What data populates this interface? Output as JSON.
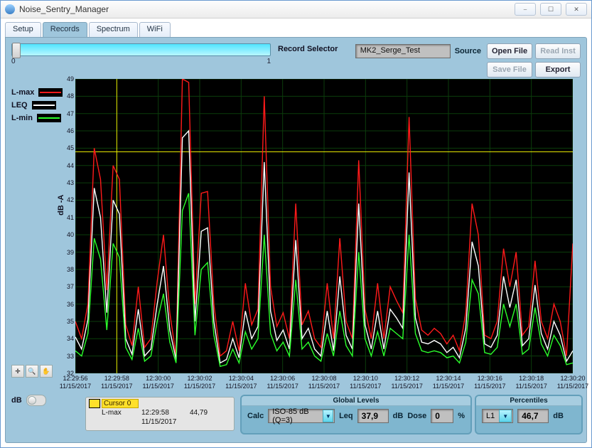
{
  "window": {
    "title": "Noise_Sentry_Manager"
  },
  "tabs": [
    "Setup",
    "Records",
    "Spectrum",
    "WiFi"
  ],
  "active_tab": 1,
  "record_selector": {
    "label": "Record Selector",
    "min": "0",
    "max": "1",
    "value": 0
  },
  "source": {
    "label": "Source",
    "value": "MK2_Serge_Test"
  },
  "buttons": {
    "open": "Open File",
    "read": "Read Inst",
    "save": "Save File",
    "export": "Export"
  },
  "legend": [
    {
      "name": "L-max",
      "color": "#ff1a1a"
    },
    {
      "name": "LEQ",
      "color": "#ffffff"
    },
    {
      "name": "L-min",
      "color": "#2bff2b"
    }
  ],
  "yaxis_label": "dB -A",
  "db_toggle_label": "dB",
  "cursor": {
    "name": "Cursor 0",
    "series": "L-max",
    "time": "12:29:58",
    "date": "11/15/2017",
    "value": "44,79"
  },
  "globals": {
    "title": "Global Levels",
    "calc_label": "Calc",
    "calc_value": "ISO-85 dB (Q=3)",
    "leq_label": "Leq",
    "leq_value": "37,9",
    "leq_unit": "dB",
    "dose_label": "Dose",
    "dose_value": "0",
    "dose_unit": "%"
  },
  "percentiles": {
    "title": "Percentiles",
    "selector": "L1",
    "value": "46,7",
    "unit": "dB"
  },
  "chart_data": {
    "type": "line",
    "xlabel": "",
    "ylabel": "dB -A",
    "ylim": [
      32,
      49
    ],
    "grid": true,
    "cursor": {
      "x": "12:29:58",
      "y": 44.8
    },
    "x_date": "11/15/2017",
    "x_ticks": [
      "12:29:56",
      "12:29:58",
      "12:30:00",
      "12:30:02",
      "12:30:04",
      "12:30:06",
      "12:30:08",
      "12:30:10",
      "12:30:12",
      "12:30:14",
      "12:30:16",
      "12:30:18",
      "12:30:20"
    ],
    "series": [
      {
        "name": "L-max",
        "color": "#ff1a1a",
        "values": [
          35.0,
          34.0,
          36.0,
          45.0,
          43.2,
          36.8,
          44.0,
          43.2,
          34.8,
          33.6,
          37.0,
          33.5,
          34.0,
          37.3,
          40.0,
          35.5,
          33.0,
          49.0,
          48.8,
          36.0,
          42.4,
          42.5,
          36.0,
          33.0,
          33.3,
          35.0,
          33.3,
          37.2,
          34.8,
          35.7,
          48.0,
          37.0,
          34.7,
          35.5,
          34.0,
          41.8,
          34.8,
          35.6,
          34.0,
          33.5,
          37.2,
          34.0,
          39.8,
          35.0,
          34.0,
          44.3,
          35.7,
          34.0,
          37.2,
          34.0,
          37.0,
          36.2,
          35.5,
          46.8,
          36.3,
          34.5,
          34.2,
          34.6,
          34.3,
          33.7,
          34.2,
          33.3,
          35.5,
          41.8,
          40.0,
          34.2,
          34.0,
          35.0,
          39.2,
          37.0,
          39.0,
          34.2,
          34.7,
          38.5,
          35.0,
          34.0,
          36.0,
          35.0,
          33.0,
          39.5
        ]
      },
      {
        "name": "LEQ",
        "color": "#ffffff",
        "values": [
          34.1,
          33.4,
          35.1,
          42.7,
          41.0,
          35.5,
          42.0,
          41.2,
          34.0,
          33.1,
          35.7,
          33.0,
          33.4,
          36.0,
          38.2,
          34.5,
          32.8,
          45.6,
          46.0,
          35.0,
          40.2,
          40.4,
          35.0,
          32.6,
          32.8,
          34.0,
          32.9,
          35.6,
          34.0,
          34.7,
          44.2,
          35.6,
          33.9,
          34.5,
          33.4,
          39.7,
          34.0,
          34.6,
          33.4,
          33.0,
          35.6,
          33.3,
          37.6,
          34.2,
          33.4,
          41.8,
          34.8,
          33.4,
          35.6,
          33.4,
          35.7,
          35.2,
          34.6,
          43.6,
          35.2,
          33.8,
          33.7,
          33.9,
          33.7,
          33.2,
          33.5,
          32.9,
          34.6,
          39.6,
          38.2,
          33.7,
          33.5,
          34.2,
          37.6,
          35.8,
          37.4,
          33.6,
          34.0,
          37.1,
          34.3,
          33.4,
          35.0,
          34.2,
          32.7,
          33.3
        ]
      },
      {
        "name": "L-min",
        "color": "#2bff2b",
        "values": [
          33.3,
          33.0,
          34.3,
          39.8,
          38.6,
          34.5,
          39.5,
          38.7,
          33.5,
          32.8,
          34.6,
          32.7,
          33.0,
          35.0,
          36.6,
          33.8,
          32.6,
          41.4,
          42.4,
          34.2,
          38.0,
          38.4,
          34.2,
          32.4,
          32.5,
          33.4,
          32.6,
          34.4,
          33.4,
          34.0,
          40.0,
          34.3,
          33.3,
          33.8,
          33.0,
          37.4,
          33.4,
          33.8,
          33.0,
          32.7,
          34.3,
          33.0,
          35.6,
          33.6,
          33.0,
          39.0,
          34.0,
          33.0,
          34.4,
          33.0,
          34.6,
          34.3,
          34.0,
          40.0,
          34.3,
          33.3,
          33.2,
          33.3,
          33.2,
          32.9,
          33.0,
          32.6,
          33.8,
          37.4,
          36.6,
          33.2,
          33.1,
          33.5,
          36.0,
          34.7,
          36.0,
          33.1,
          33.4,
          35.8,
          33.7,
          33.0,
          34.2,
          33.6,
          32.5,
          32.6
        ]
      }
    ]
  }
}
